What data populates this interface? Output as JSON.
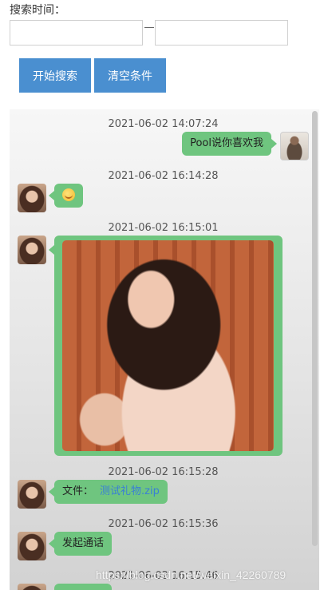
{
  "search": {
    "label": "搜索时间：",
    "start_value": "",
    "end_value": ""
  },
  "buttons": {
    "search_label": "开始搜索",
    "clear_label": "清空条件"
  },
  "messages": [
    {
      "time": "2021-06-02 14:07:24",
      "side": "right",
      "type": "text",
      "text": "Pool说你喜欢我"
    },
    {
      "time": "2021-06-02 16:14:28",
      "side": "left",
      "type": "emoji",
      "icon": "smiley-emoji-icon"
    },
    {
      "time": "2021-06-02 16:15:01",
      "side": "left",
      "type": "image"
    },
    {
      "time": "2021-06-02 16:15:28",
      "side": "left",
      "type": "file",
      "prefix": "文件：",
      "filename": "测试礼物.zip"
    },
    {
      "time": "2021-06-02 16:15:36",
      "side": "left",
      "type": "text",
      "text": "发起通话"
    },
    {
      "time": "2021-06-02 16:15:46",
      "side": "left",
      "type": "text",
      "text": ""
    }
  ],
  "watermark": "https://blog.csdn.net/weixin_42260789",
  "colors": {
    "button_bg": "#4a8fd0",
    "bubble_bg": "#6fc57f",
    "file_link": "#3a7fd6"
  }
}
